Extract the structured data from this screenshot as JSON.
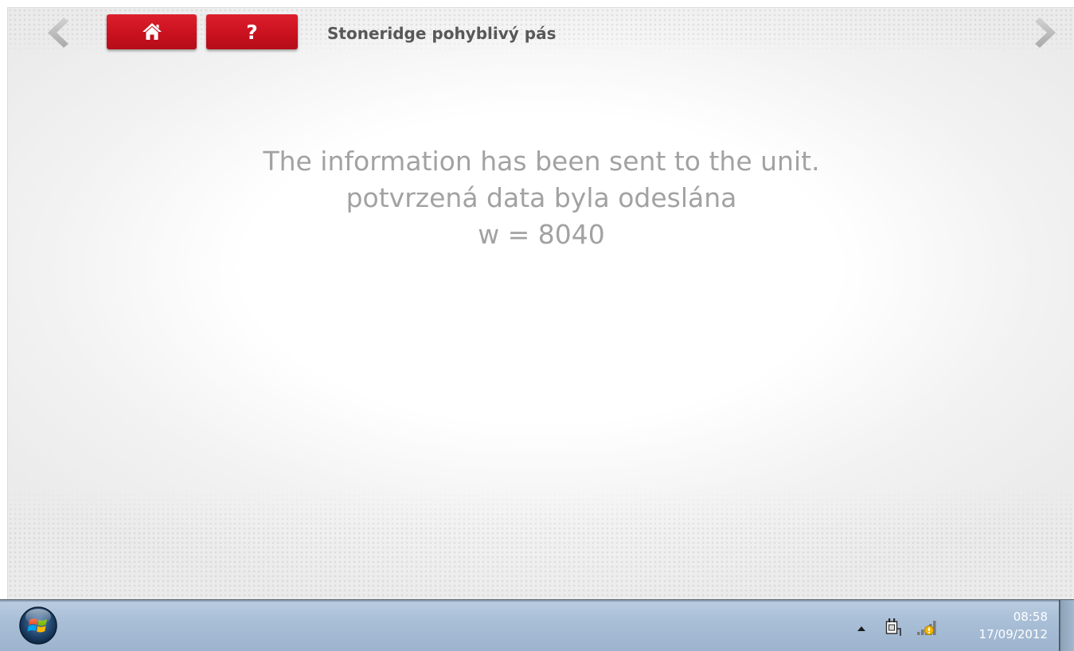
{
  "header": {
    "title": "Stoneridge pohyblivý pás",
    "home_icon": "home-icon",
    "help_label": "?",
    "prev_icon": "chevron-left-icon",
    "next_icon": "chevron-right-icon",
    "button_color": "#c8101e"
  },
  "message": {
    "line1": "The information has been sent to the unit.",
    "line2": "potvrzená data byla odeslána",
    "line3": "w = 8040",
    "color": "#a2a2a2"
  },
  "taskbar": {
    "start_icon": "windows-start-icon",
    "tray_icons": [
      "show-hidden-icons-arrow",
      "power-plug-icon",
      "signal-bars-icon"
    ],
    "clock": {
      "time": "08:58",
      "date": "17/09/2012"
    }
  }
}
